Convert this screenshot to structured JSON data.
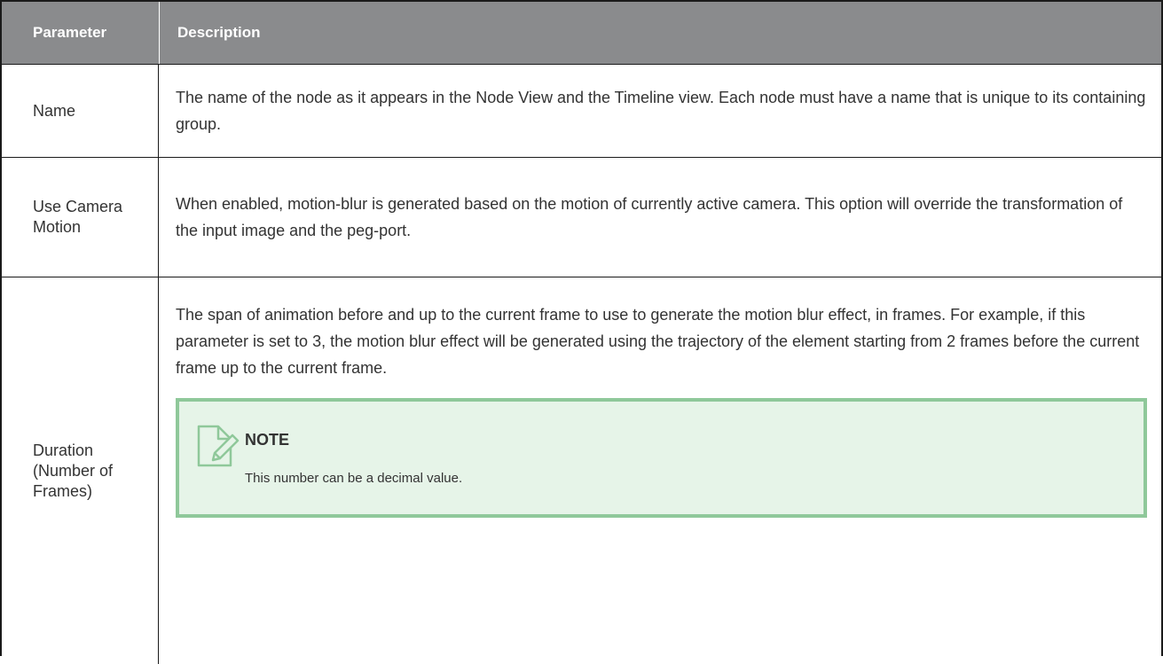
{
  "table": {
    "header": {
      "parameter": "Parameter",
      "description": "Description"
    },
    "rows": [
      {
        "parameter": "Name",
        "description": "The name of the node as it appears in the Node View and the Timeline view. Each node must have a name that is unique to its containing group."
      },
      {
        "parameter": "Use Camera Motion",
        "description": "When enabled, motion-blur is generated based on the motion of currently active camera. This option will override the transformation of the input image and the peg-port."
      },
      {
        "parameter": "Duration (Number of Frames)",
        "description": "The span of animation before and up to the current frame to use to generate the motion blur effect, in frames. For example, if this parameter is set to 3, the motion blur effect will be generated using the trajectory of the element starting from 2 frames before the current frame up to the current frame.",
        "note": {
          "title": "NOTE",
          "text": "This number can be a decimal value.",
          "icon": "note-edit-icon"
        }
      }
    ]
  },
  "colors": {
    "header_bg": "#8a8b8d",
    "note_border": "#8fc89a",
    "note_bg": "#e6f4e8",
    "text": "#333333"
  }
}
